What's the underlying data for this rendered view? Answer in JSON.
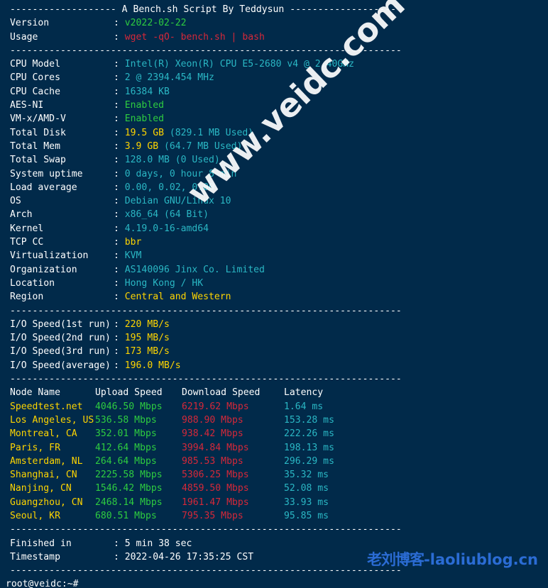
{
  "terminal": {
    "background_color": "#012a4a",
    "prompt": "root@veidc:~#",
    "separator": "----------------------------------------------------------------------"
  },
  "header": {
    "title": "A Bench.sh Script By Teddysun",
    "dashes_left": "-------------------",
    "dashes_right": "-------------------"
  },
  "script_info": [
    {
      "label": "Version",
      "value": "v2022-02-22",
      "color": "green"
    },
    {
      "label": "Usage",
      "value": "wget -qO- bench.sh | bash",
      "color": "red"
    }
  ],
  "system_info": [
    {
      "label": "CPU Model",
      "value": "Intel(R) Xeon(R) CPU E5-2680 v4 @ 2.40GHz",
      "color": "cyan"
    },
    {
      "label": "CPU Cores",
      "value": "2 @ 2394.454 MHz",
      "color": "cyan"
    },
    {
      "label": "CPU Cache",
      "value": "16384 KB",
      "color": "cyan"
    },
    {
      "label": "AES-NI",
      "value": "Enabled",
      "color": "green"
    },
    {
      "label": "VM-x/AMD-V",
      "value": "Enabled",
      "color": "green"
    },
    {
      "label": "Total Disk",
      "value": "19.5 GB",
      "value2": " (829.1 MB Used)",
      "color": "yellow",
      "color2": "cyan"
    },
    {
      "label": "Total Mem",
      "value": "3.9 GB",
      "value2": " (64.7 MB Used)",
      "color": "yellow",
      "color2": "cyan"
    },
    {
      "label": "Total Swap",
      "value": "128.0 MB (0 Used)",
      "color": "cyan"
    },
    {
      "label": "System uptime",
      "value": "0 days, 0 hour 8 min",
      "color": "cyan"
    },
    {
      "label": "Load average",
      "value": "0.00, 0.02, 0.00",
      "color": "cyan"
    },
    {
      "label": "OS",
      "value": "Debian GNU/Linux 10",
      "color": "cyan"
    },
    {
      "label": "Arch",
      "value": "x86_64 (64 Bit)",
      "color": "cyan"
    },
    {
      "label": "Kernel",
      "value": "4.19.0-16-amd64",
      "color": "cyan"
    },
    {
      "label": "TCP CC",
      "value": "bbr",
      "color": "yellow"
    },
    {
      "label": "Virtualization",
      "value": "KVM",
      "color": "cyan"
    },
    {
      "label": "Organization",
      "value": "AS140096 Jinx Co. Limited",
      "color": "cyan"
    },
    {
      "label": "Location",
      "value": "Hong Kong / HK",
      "color": "cyan"
    },
    {
      "label": "Region",
      "value": "Central and Western",
      "color": "yellow"
    }
  ],
  "io_speed": [
    {
      "label": "I/O Speed(1st run)",
      "value": "220 MB/s",
      "color": "yellow"
    },
    {
      "label": "I/O Speed(2nd run)",
      "value": "195 MB/s",
      "color": "yellow"
    },
    {
      "label": "I/O Speed(3rd run)",
      "value": "173 MB/s",
      "color": "yellow"
    },
    {
      "label": "I/O Speed(average)",
      "value": "196.0 MB/s",
      "color": "yellow"
    }
  ],
  "speedtest": {
    "columns": [
      "Node Name",
      "Upload Speed",
      "Download Speed",
      "Latency"
    ],
    "rows": [
      {
        "node": "Speedtest.net",
        "upload": "4046.50 Mbps",
        "download": "6219.62 Mbps",
        "latency": "1.64 ms"
      },
      {
        "node": "Los Angeles, US",
        "upload": "536.58 Mbps",
        "download": "988.90 Mbps",
        "latency": "153.28 ms"
      },
      {
        "node": "Montreal, CA",
        "upload": "352.01 Mbps",
        "download": "938.42 Mbps",
        "latency": "222.26 ms"
      },
      {
        "node": "Paris, FR",
        "upload": "412.64 Mbps",
        "download": "3994.84 Mbps",
        "latency": "198.13 ms"
      },
      {
        "node": "Amsterdam, NL",
        "upload": "264.64 Mbps",
        "download": "985.53 Mbps",
        "latency": "296.29 ms"
      },
      {
        "node": "Shanghai, CN",
        "upload": "2225.58 Mbps",
        "download": "5306.25 Mbps",
        "latency": "35.32 ms"
      },
      {
        "node": "Nanjing, CN",
        "upload": "1546.42 Mbps",
        "download": "4859.50 Mbps",
        "latency": "52.08 ms"
      },
      {
        "node": "Guangzhou, CN",
        "upload": "2468.14 Mbps",
        "download": "1961.47 Mbps",
        "latency": "33.93 ms"
      },
      {
        "node": "Seoul, KR",
        "upload": "680.51 Mbps",
        "download": "795.35 Mbps",
        "latency": "95.85 ms"
      }
    ]
  },
  "summary": [
    {
      "label": "Finished in",
      "value": "5 min 38 sec",
      "color": "white"
    },
    {
      "label": "Timestamp",
      "value": "2022-04-26 17:35:25 CST",
      "color": "white"
    }
  ],
  "watermarks": {
    "diagonal": "www.veidc.com",
    "diagonal_color": "#ffffff",
    "bottom_cjk": "老刘博客",
    "bottom_latin": "-laoliublog.cn",
    "bottom_color": "#2b6cd4"
  }
}
